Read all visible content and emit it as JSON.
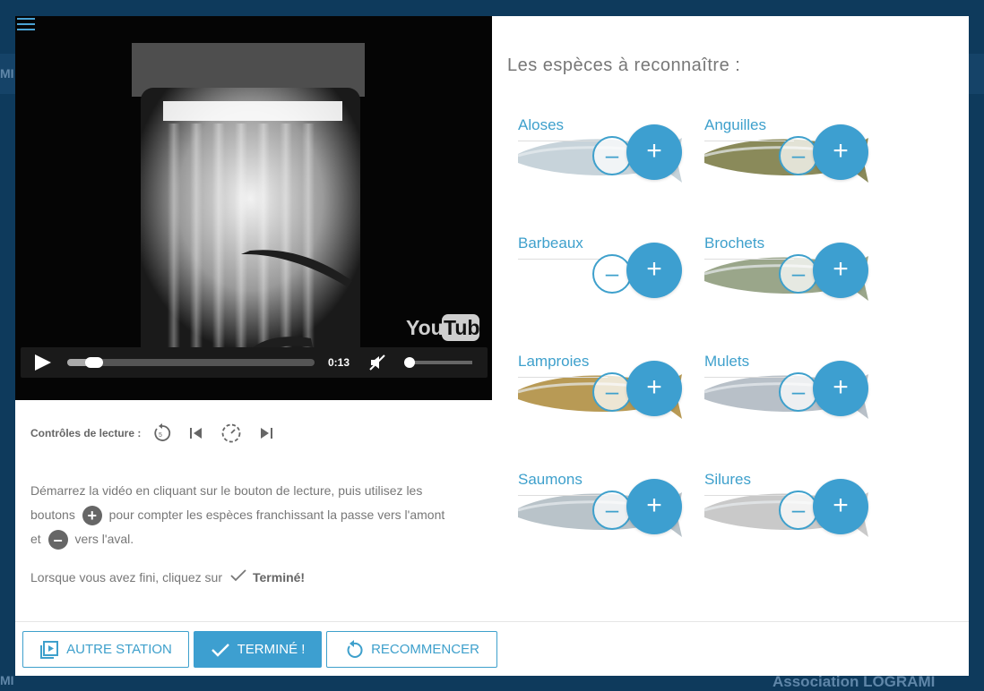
{
  "background": {
    "left_text": "MI",
    "bottom_right_text": "Association LOGRAMI",
    "bottom_left_text": "MI"
  },
  "video": {
    "watermark": "YouTube",
    "time": "0:13",
    "progress_fraction": 0.11,
    "volume_fraction": 0.0
  },
  "controls": {
    "label": "Contrôles de lecture :"
  },
  "instructions": {
    "part1": "Démarrez la vidéo en cliquant sur le bouton de lecture, puis utilisez les boutons",
    "plus_symbol": "+",
    "part2": "pour compter les espèces franchissant la passe vers l'amont et",
    "minus_symbol": "–",
    "part3": "vers l'aval.",
    "done_prefix": "Lorsque vous avez fini, cliquez sur",
    "done_word": "Terminé!"
  },
  "species_title": "Les espèces à reconnaître :",
  "species": [
    {
      "name": "Aloses",
      "minus": "–",
      "plus": "+"
    },
    {
      "name": "Anguilles",
      "minus": "–",
      "plus": "+"
    },
    {
      "name": "Barbeaux",
      "minus": "–",
      "plus": "+"
    },
    {
      "name": "Brochets",
      "minus": "–",
      "plus": "+"
    },
    {
      "name": "Lamproies",
      "minus": "–",
      "plus": "+"
    },
    {
      "name": "Mulets",
      "minus": "–",
      "plus": "+"
    },
    {
      "name": "Saumons",
      "minus": "–",
      "plus": "+"
    },
    {
      "name": "Silures",
      "minus": "–",
      "plus": "+"
    }
  ],
  "footer": {
    "other_station": "AUTRE STATION",
    "done": "TERMINÉ !",
    "restart": "RECOMMENCER"
  },
  "colors": {
    "accent": "#3d9fd0",
    "background": "#0e3a5c"
  }
}
